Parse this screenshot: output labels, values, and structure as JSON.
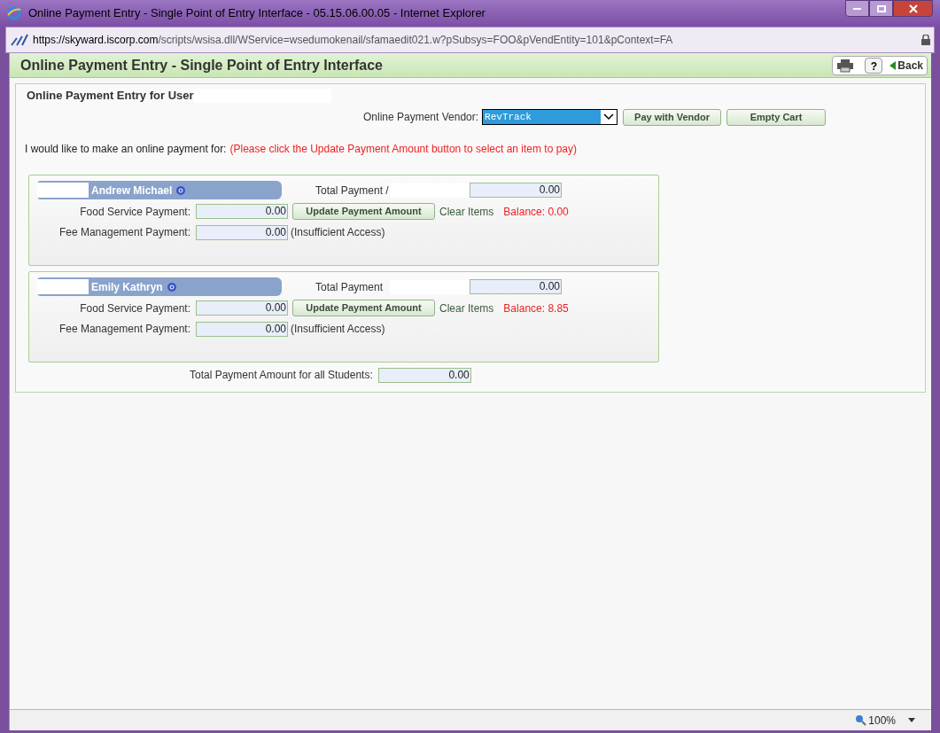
{
  "window": {
    "title": "Online Payment Entry - Single Point of Entry Interface - 05.15.06.00.05 - Internet Explorer",
    "url_host": "https://skyward.",
    "url_domain": "iscorp.com",
    "url_path": "/scripts/wsisa.dll/WService=wsedumokenail/sfamaedit021.w?pSubsys=FOO&pVendEntity=101&pContext=FA"
  },
  "page": {
    "title": "Online Payment Entry - Single Point of Entry Interface",
    "back": "Back",
    "help": "?"
  },
  "panel": {
    "heading": "Online Payment Entry for User",
    "vendor_label": "Online Payment Vendor:",
    "vendor": "RevTrack",
    "pay_button": "Pay with Vendor",
    "empty_button": "Empty Cart",
    "intro": "I would like to make an online payment for:",
    "instruction": "(Please click the Update Payment Amount button to select an item to pay)"
  },
  "students": [
    {
      "name": "Andrew Michael",
      "total_label": "Total Payment /",
      "total": "0.00",
      "food_label": "Food Service Payment:",
      "food": "0.00",
      "update_button": "Update Payment Amount",
      "clear": "Clear Items",
      "balance": "Balance: 0.00",
      "fee_label": "Fee Management Payment:",
      "fee": "0.00",
      "fee_note": "(Insufficient Access)"
    },
    {
      "name": "Emily Kathryn",
      "total_label": "Total Payment",
      "total": "0.00",
      "food_label": "Food Service Payment:",
      "food": "0.00",
      "update_button": "Update Payment Amount",
      "clear": "Clear Items",
      "balance": "Balance: 8.85",
      "fee_label": "Fee Management Payment:",
      "fee": "0.00",
      "fee_note": "(Insufficient Access)"
    }
  ],
  "grand_total": {
    "label": "Total Payment Amount for all Students:",
    "value": "0.00"
  },
  "status_bar": {
    "zoom": "100%"
  }
}
